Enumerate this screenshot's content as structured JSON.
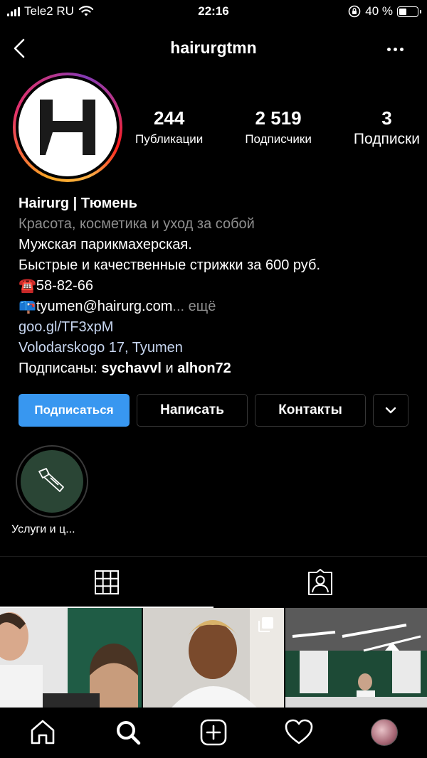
{
  "status_bar": {
    "carrier": "Tele2 RU",
    "time": "22:16",
    "battery": "40 %"
  },
  "header": {
    "username": "hairurgtmn"
  },
  "profile": {
    "stats": [
      {
        "value": "244",
        "label": "Публикации"
      },
      {
        "value": "2 519",
        "label": "Подписчики"
      },
      {
        "value": "3",
        "label": "Подписки"
      }
    ],
    "name": "Hairurg | Тюмень",
    "category": "Красота, косметика и уход за собой",
    "bio_line1": "Мужская парикмахерская.",
    "bio_line2": "Быстрые и качественные стрижки за 600 руб.",
    "phone_emoji": "☎️",
    "phone": "58-82-66",
    "mail_emoji": "📪",
    "email": "tyumen@hairurg.com",
    "more": "... ещё",
    "link": "goo.gl/TF3xpM",
    "address": "Volodarskogo 17, Tyumen",
    "followed_by_prefix": "Подписаны: ",
    "followed_by_user1": "sychavvl",
    "followed_by_and": " и ",
    "followed_by_user2": "alhon72"
  },
  "actions": {
    "follow": "Подписаться",
    "message": "Написать",
    "contacts": "Контакты"
  },
  "highlights": [
    {
      "label": "Услуги и ц...",
      "icon": "razor-icon"
    }
  ],
  "tabs": [
    {
      "name": "grid",
      "icon": "grid-icon",
      "active": true
    },
    {
      "name": "tagged",
      "icon": "tagged-person-icon",
      "active": false
    }
  ],
  "nav": [
    "home-icon",
    "search-icon",
    "new-post-icon",
    "activity-heart-icon",
    "profile-avatar"
  ],
  "colors": {
    "follow_button": "#3897f0",
    "link": "#c7d6f0",
    "muted": "#8e8e8e"
  }
}
